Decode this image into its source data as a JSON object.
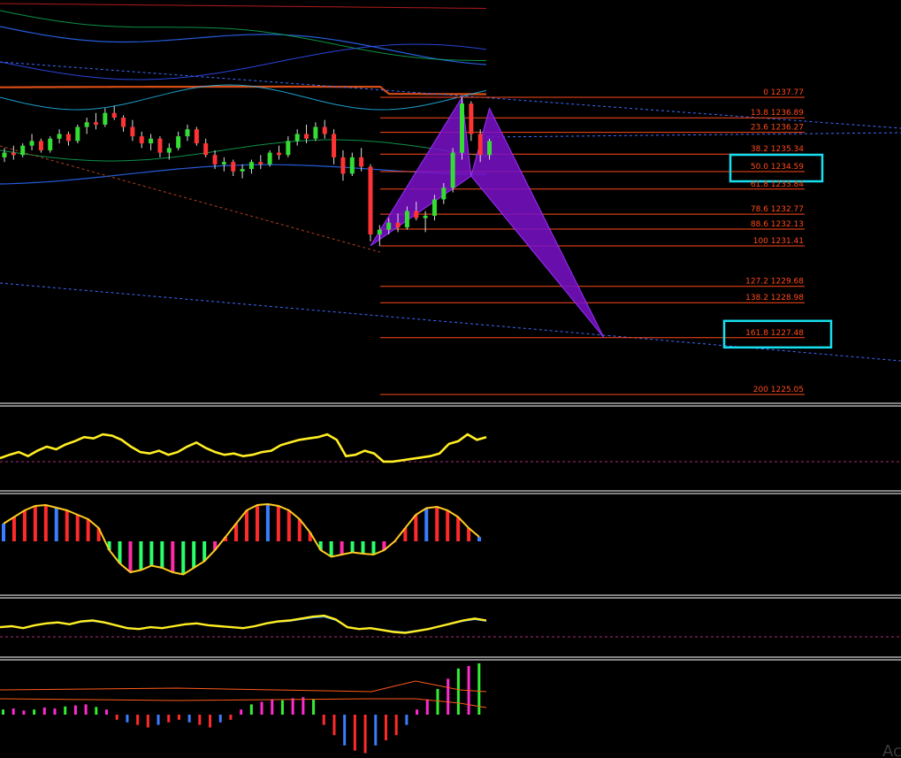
{
  "chart_data": {
    "type": "candlestick",
    "fibonacci": {
      "color": "#ff4a1a",
      "levels": [
        {
          "label": "0 1237.77",
          "ratio": 0,
          "price": 1237.77
        },
        {
          "label": "13.8 1236.89",
          "ratio": 13.8,
          "price": 1236.89
        },
        {
          "label": "23.6 1236.27",
          "ratio": 23.6,
          "price": 1236.27
        },
        {
          "label": "38.2 1235.34",
          "ratio": 38.2,
          "price": 1235.34
        },
        {
          "label": "50.0 1234.59",
          "ratio": 50.0,
          "price": 1234.59
        },
        {
          "label": "61.8 1233.84",
          "ratio": 61.8,
          "price": 1233.84
        },
        {
          "label": "78.6 1232.77",
          "ratio": 78.6,
          "price": 1232.77
        },
        {
          "label": "88.6 1232.13",
          "ratio": 88.6,
          "price": 1232.13
        },
        {
          "label": "100 1231.41",
          "ratio": 100,
          "price": 1231.41
        },
        {
          "label": "127.2 1229.68",
          "ratio": 127.2,
          "price": 1229.68
        },
        {
          "label": "138.2 1228.98",
          "ratio": 138.2,
          "price": 1228.98
        },
        {
          "label": "161.8 1227.48",
          "ratio": 161.8,
          "price": 1227.48
        },
        {
          "label": "200 1225.05",
          "ratio": 200,
          "price": 1225.05
        }
      ],
      "highlighted_ratios": [
        50.0,
        161.8
      ],
      "highlight_color": "#16e0f0"
    },
    "candles": {
      "up_color": "#33dd33",
      "down_color": "#ff3333",
      "ohlc": [
        [
          1235.2,
          1235.6,
          1235.0,
          1235.4
        ],
        [
          1235.4,
          1235.7,
          1235.1,
          1235.3
        ],
        [
          1235.3,
          1235.8,
          1235.2,
          1235.7
        ],
        [
          1235.7,
          1236.2,
          1235.5,
          1235.9
        ],
        [
          1235.9,
          1236.0,
          1235.4,
          1235.5
        ],
        [
          1235.5,
          1236.1,
          1235.4,
          1236.0
        ],
        [
          1236.0,
          1236.4,
          1235.8,
          1236.2
        ],
        [
          1236.2,
          1236.3,
          1235.7,
          1235.9
        ],
        [
          1235.9,
          1236.6,
          1235.8,
          1236.5
        ],
        [
          1236.5,
          1236.9,
          1236.2,
          1236.7
        ],
        [
          1236.7,
          1237.1,
          1236.4,
          1236.6
        ],
        [
          1236.6,
          1237.3,
          1236.5,
          1237.1
        ],
        [
          1237.1,
          1237.4,
          1236.8,
          1236.9
        ],
        [
          1236.9,
          1237.0,
          1236.3,
          1236.5
        ],
        [
          1236.5,
          1236.8,
          1235.9,
          1236.1
        ],
        [
          1236.1,
          1236.3,
          1235.6,
          1235.8
        ],
        [
          1235.8,
          1236.2,
          1235.5,
          1236.0
        ],
        [
          1236.0,
          1236.1,
          1235.2,
          1235.4
        ],
        [
          1235.4,
          1235.8,
          1235.1,
          1235.6
        ],
        [
          1235.6,
          1236.3,
          1235.5,
          1236.1
        ],
        [
          1236.1,
          1236.6,
          1235.9,
          1236.4
        ],
        [
          1236.4,
          1236.5,
          1235.7,
          1235.8
        ],
        [
          1235.8,
          1236.0,
          1235.2,
          1235.3
        ],
        [
          1235.3,
          1235.5,
          1234.7,
          1234.9
        ],
        [
          1234.9,
          1235.2,
          1234.6,
          1235.0
        ],
        [
          1235.0,
          1235.1,
          1234.4,
          1234.6
        ],
        [
          1234.6,
          1234.9,
          1234.3,
          1234.7
        ],
        [
          1234.7,
          1235.1,
          1234.5,
          1235.0
        ],
        [
          1235.0,
          1235.3,
          1234.7,
          1234.9
        ],
        [
          1234.9,
          1235.5,
          1234.8,
          1235.4
        ],
        [
          1235.4,
          1235.7,
          1235.1,
          1235.3
        ],
        [
          1235.3,
          1236.1,
          1235.2,
          1235.9
        ],
        [
          1235.9,
          1236.4,
          1235.7,
          1236.2
        ],
        [
          1236.2,
          1236.6,
          1235.8,
          1236.0
        ],
        [
          1236.0,
          1236.7,
          1235.9,
          1236.5
        ],
        [
          1236.5,
          1236.8,
          1236.0,
          1236.2
        ],
        [
          1236.2,
          1236.4,
          1234.9,
          1235.2
        ],
        [
          1235.2,
          1235.5,
          1234.2,
          1234.5
        ],
        [
          1234.5,
          1235.4,
          1234.4,
          1235.2
        ],
        [
          1235.2,
          1235.6,
          1234.6,
          1234.8
        ],
        [
          1234.8,
          1234.9,
          1231.6,
          1231.9
        ],
        [
          1231.9,
          1232.3,
          1231.4,
          1232.1
        ],
        [
          1232.1,
          1232.6,
          1231.9,
          1232.4
        ],
        [
          1232.4,
          1232.8,
          1232.0,
          1232.2
        ],
        [
          1232.2,
          1233.1,
          1232.1,
          1232.9
        ],
        [
          1232.9,
          1233.3,
          1232.5,
          1232.6
        ],
        [
          1232.6,
          1232.9,
          1232.0,
          1232.7
        ],
        [
          1232.7,
          1233.6,
          1232.5,
          1233.4
        ],
        [
          1233.4,
          1234.1,
          1233.2,
          1233.9
        ],
        [
          1233.9,
          1235.6,
          1233.7,
          1235.4
        ],
        [
          1235.4,
          1237.77,
          1235.1,
          1237.5
        ],
        [
          1237.5,
          1237.6,
          1235.9,
          1236.2
        ],
        [
          1236.2,
          1236.4,
          1235.0,
          1235.3
        ],
        [
          1235.3,
          1236.0,
          1235.1,
          1235.9
        ]
      ]
    },
    "harmonic_pattern": {
      "type": "butterfly",
      "color": "#7a10c8",
      "points": [
        {
          "bar": 40,
          "price": 1231.41
        },
        {
          "bar": 50,
          "price": 1237.77
        },
        {
          "bar": 51,
          "price": 1234.4
        },
        {
          "bar": 53,
          "price": 1237.3
        },
        {
          "bar": 60,
          "price": 1227.48
        }
      ]
    },
    "oscillators": [
      {
        "name": "",
        "type": "line",
        "range": [
          0,
          100
        ],
        "values": [
          35,
          40,
          44,
          38,
          46,
          52,
          48,
          55,
          60,
          66,
          64,
          70,
          68,
          62,
          52,
          44,
          42,
          46,
          40,
          44,
          52,
          58,
          50,
          44,
          40,
          42,
          38,
          40,
          44,
          46,
          54,
          58,
          62,
          64,
          66,
          70,
          62,
          38,
          40,
          46,
          42,
          30,
          30,
          32,
          34,
          36,
          38,
          42,
          56,
          60,
          70,
          62,
          66
        ]
      },
      {
        "name": "",
        "type": "histogram",
        "range": [
          -100,
          100
        ],
        "values": [
          40,
          55,
          70,
          80,
          82,
          76,
          70,
          60,
          50,
          30,
          -20,
          -50,
          -70,
          -65,
          -55,
          -60,
          -70,
          -75,
          -60,
          -45,
          -20,
          10,
          40,
          70,
          82,
          84,
          80,
          70,
          50,
          20,
          -20,
          -35,
          -30,
          -25,
          -28,
          -30,
          -20,
          0,
          30,
          60,
          75,
          78,
          70,
          55,
          30,
          10
        ]
      },
      {
        "name": "",
        "type": "lines",
        "range": [
          0,
          100
        ],
        "values": [
          48,
          50,
          46,
          52,
          56,
          58,
          54,
          60,
          62,
          58,
          52,
          46,
          44,
          48,
          46,
          50,
          54,
          56,
          52,
          50,
          48,
          46,
          50,
          56,
          60,
          62,
          66,
          70,
          72,
          64,
          48,
          44,
          46,
          42,
          38,
          36,
          40,
          44,
          50,
          56,
          62,
          66,
          62
        ]
      },
      {
        "name": "",
        "type": "histogram",
        "range": [
          -100,
          100
        ],
        "values": [
          10,
          12,
          8,
          10,
          14,
          12,
          16,
          18,
          20,
          15,
          10,
          -10,
          -15,
          -20,
          -25,
          -20,
          -15,
          -10,
          -15,
          -20,
          -25,
          -15,
          -10,
          10,
          20,
          25,
          30,
          28,
          32,
          34,
          30,
          -20,
          -40,
          -60,
          -70,
          -75,
          -60,
          -50,
          -40,
          -20,
          10,
          30,
          50,
          70,
          90,
          95,
          100
        ]
      }
    ]
  }
}
